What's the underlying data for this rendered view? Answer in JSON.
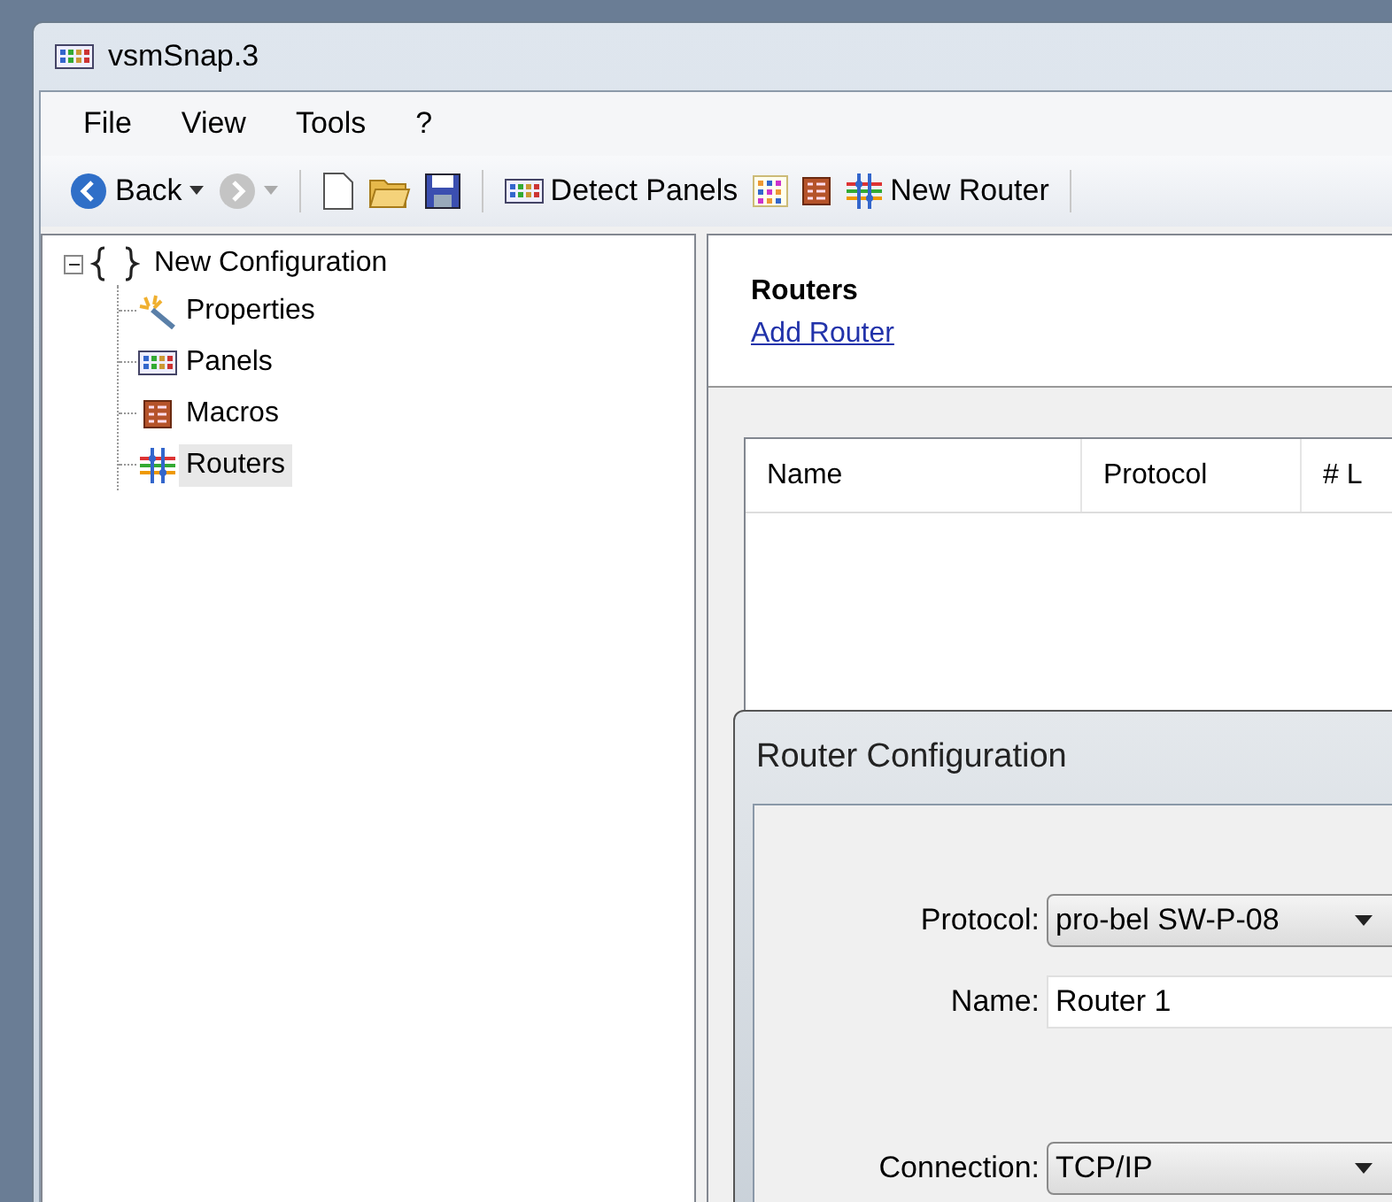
{
  "window": {
    "title": "vsmSnap.3"
  },
  "menu": [
    "File",
    "View",
    "Tools",
    "?"
  ],
  "toolbar": [
    {
      "kind": "back",
      "label": "Back",
      "disabled": false
    },
    {
      "kind": "forward",
      "disabled": true
    },
    {
      "kind": "separator"
    },
    {
      "kind": "new"
    },
    {
      "kind": "open"
    },
    {
      "kind": "save"
    },
    {
      "kind": "separator"
    },
    {
      "kind": "panels",
      "label": "Detect Panels"
    },
    {
      "kind": "grid"
    },
    {
      "kind": "macros"
    },
    {
      "kind": "router",
      "label": "New Router"
    },
    {
      "kind": "separator"
    }
  ],
  "tree": {
    "label": "New Configuration",
    "expanded": true,
    "selected": false,
    "children": [
      {
        "kind": "properties",
        "label": "Properties",
        "selected": false
      },
      {
        "kind": "panels",
        "label": "Panels",
        "selected": false
      },
      {
        "kind": "macros",
        "label": "Macros",
        "selected": false
      },
      {
        "kind": "router",
        "label": "Routers",
        "selected": true
      }
    ]
  },
  "content": {
    "heading": "Routers",
    "link": "Add Router",
    "table": {
      "columns": [
        "Name",
        "Protocol",
        "# L"
      ]
    }
  },
  "dialog": {
    "title": "Router Configuration",
    "fields": [
      {
        "kind": "combo",
        "label": "Protocol:",
        "value": "pro-bel SW-P-08"
      },
      {
        "kind": "text",
        "label": "Name:",
        "value": "Router 1"
      },
      {
        "kind": "combo",
        "label": "Connection:",
        "value": "TCP/IP"
      }
    ]
  }
}
